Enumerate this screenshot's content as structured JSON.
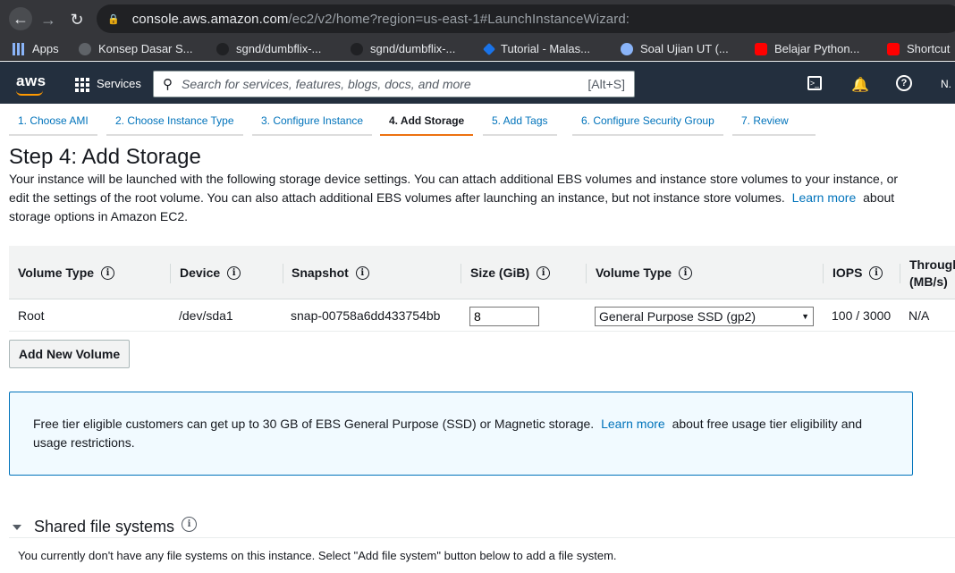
{
  "browser": {
    "url_host": "console.aws.amazon.com",
    "url_path": "/ec2/v2/home?region=us-east-1#LaunchInstanceWizard:",
    "bookmarks": [
      "Apps",
      "Konsep Dasar S...",
      "sgnd/dumbflix-...",
      "sgnd/dumbflix-...",
      "Tutorial - Malas...",
      "Soal Ujian UT (...",
      "Belajar Python...",
      "Shortcut"
    ]
  },
  "header": {
    "logo": "aws",
    "services": "Services",
    "search_placeholder": "Search for services, features, blogs, docs, and more",
    "search_shortcut": "[Alt+S]",
    "user": "N."
  },
  "tabs": [
    {
      "label": "1. Choose AMI"
    },
    {
      "label": "2. Choose Instance Type"
    },
    {
      "label": "3. Configure Instance"
    },
    {
      "label": "4. Add Storage"
    },
    {
      "label": "5. Add Tags"
    },
    {
      "label": "6. Configure Security Group"
    },
    {
      "label": "7. Review"
    }
  ],
  "page": {
    "title": "Step 4: Add Storage",
    "desc_1": "Your instance will be launched with the following storage device settings. You can attach additional EBS volumes and instance store volumes to your instance, or edit the settings of the root volume. You can also attach additional EBS volumes after launching an instance, but not instance store volumes.",
    "learn_more": "Learn more",
    "desc_2": "about storage options in Amazon EC2."
  },
  "table": {
    "headers": {
      "volume_type": "Volume Type",
      "device": "Device",
      "snapshot": "Snapshot",
      "size": "Size (GiB)",
      "ebs_type": "Volume Type",
      "iops": "IOPS",
      "throughput_1": "Throughput",
      "throughput_2": "(MB/s)"
    },
    "row": {
      "volume_type": "Root",
      "device": "/dev/sda1",
      "snapshot": "snap-00758a6dd433754bb",
      "size": "8",
      "ebs_type": "General Purpose SSD (gp2)",
      "iops": "100 / 3000",
      "throughput": "N/A"
    }
  },
  "add_volume": "Add New Volume",
  "alert": {
    "text_1": "Free tier eligible customers can get up to 30 GB of EBS General Purpose (SSD) or Magnetic storage.",
    "learn_more": "Learn more",
    "text_2": "about free usage tier eligibility and usage restrictions."
  },
  "shared": {
    "title": "Shared file systems",
    "empty": "You currently don't have any file systems on this instance. Select \"Add file system\" button below to add a file system."
  }
}
